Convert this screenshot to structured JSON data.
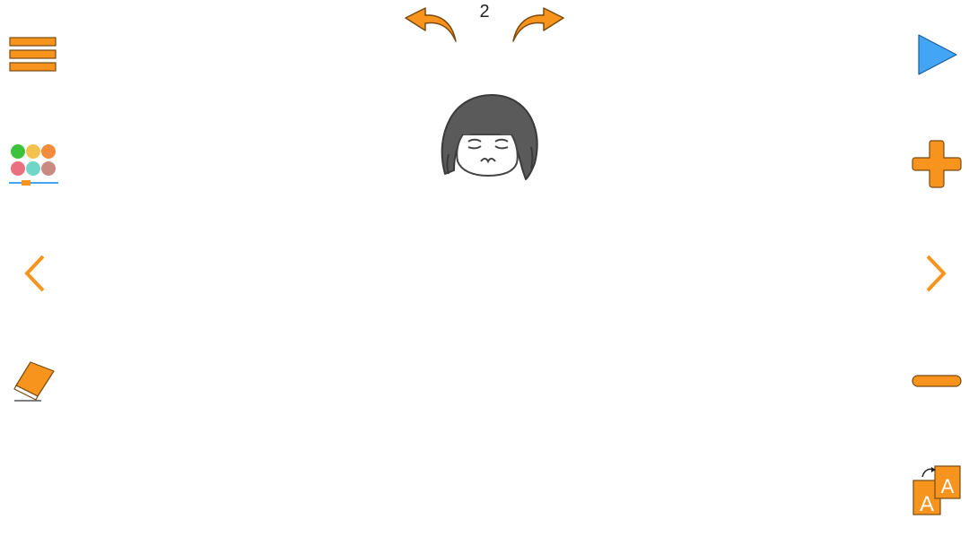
{
  "toolbar": {
    "page_number": "2",
    "text_size_glyph_small": "A",
    "text_size_glyph_large": "A"
  },
  "icons": {
    "menu": "hamburger-menu-icon",
    "palette": "color-palette-icon",
    "prev": "chevron-left-icon",
    "eraser": "eraser-icon",
    "undo": "undo-arrow-icon",
    "redo": "redo-arrow-icon",
    "play": "play-icon",
    "zoom_in": "plus-icon",
    "next": "chevron-right-icon",
    "zoom_out": "minus-icon",
    "text_size": "text-size-icon"
  },
  "colors": {
    "accent": "#f7941d",
    "play": "#42a5f5",
    "palette": [
      "#3cc23c",
      "#f2c14e",
      "#f28c3c",
      "#ec6f7f",
      "#6fd6c8",
      "#c98a82"
    ],
    "palette_slider": "#42a5f5",
    "drawing_ink": "#5a5a5a"
  }
}
